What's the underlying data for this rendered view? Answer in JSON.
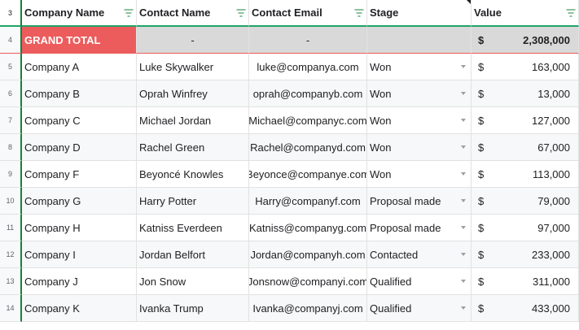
{
  "headers": {
    "row_number": "3",
    "company": "Company Name",
    "contact": "Contact Name",
    "email": "Contact Email",
    "stage": "Stage",
    "value": "Value"
  },
  "total": {
    "row_number": "4",
    "label": "GRAND TOTAL",
    "contact": "-",
    "email": "-",
    "currency": "$",
    "value": "2,308,000"
  },
  "rows": [
    {
      "n": "5",
      "company": "Company A",
      "contact": "Luke Skywalker",
      "email": "luke@companya.com",
      "stage": "Won",
      "currency": "$",
      "value": "163,000"
    },
    {
      "n": "6",
      "company": "Company B",
      "contact": "Oprah Winfrey",
      "email": "oprah@companyb.com",
      "stage": "Won",
      "currency": "$",
      "value": "13,000"
    },
    {
      "n": "7",
      "company": "Company C",
      "contact": "Michael Jordan",
      "email": "Michael@companyc.com",
      "stage": "Won",
      "currency": "$",
      "value": "127,000"
    },
    {
      "n": "8",
      "company": "Company D",
      "contact": "Rachel Green",
      "email": "Rachel@companyd.com",
      "stage": "Won",
      "currency": "$",
      "value": "67,000"
    },
    {
      "n": "9",
      "company": "Company F",
      "contact": "Beyoncé Knowles",
      "email": "Beyonce@companye.com",
      "stage": "Won",
      "currency": "$",
      "value": "113,000"
    },
    {
      "n": "10",
      "company": "Company G",
      "contact": "Harry Potter",
      "email": "Harry@companyf.com",
      "stage": "Proposal made",
      "currency": "$",
      "value": "79,000"
    },
    {
      "n": "11",
      "company": "Company H",
      "contact": "Katniss Everdeen",
      "email": "Katniss@companyg.com",
      "stage": "Proposal made",
      "currency": "$",
      "value": "97,000"
    },
    {
      "n": "12",
      "company": "Company I",
      "contact": "Jordan Belfort",
      "email": "Jordan@companyh.com",
      "stage": "Contacted",
      "currency": "$",
      "value": "233,000"
    },
    {
      "n": "13",
      "company": "Company J",
      "contact": "Jon Snow",
      "email": "Jonsnow@companyi.com",
      "stage": "Qualified",
      "currency": "$",
      "value": "311,000"
    },
    {
      "n": "14",
      "company": "Company K",
      "contact": "Ivanka Trump",
      "email": "Ivanka@companyj.com",
      "stage": "Qualified",
      "currency": "$",
      "value": "433,000"
    }
  ],
  "colors": {
    "accent": "#21a366",
    "total_label_bg": "#ec5c5c",
    "total_row_bg": "#d9d9d9"
  }
}
